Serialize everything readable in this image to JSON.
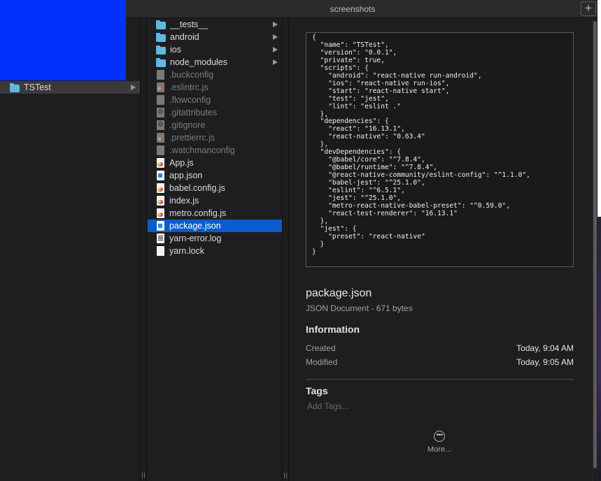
{
  "window": {
    "title": "screenshots",
    "new_tab_symbol": "+"
  },
  "column1": [
    {
      "label": "TSTest",
      "icon": "folder-icon",
      "selected": true,
      "has_children": true
    }
  ],
  "column2": [
    {
      "label": "__tests__",
      "icon": "folder-icon",
      "kind": "folder"
    },
    {
      "label": "android",
      "icon": "folder-icon",
      "kind": "folder"
    },
    {
      "label": "ios",
      "icon": "folder-icon",
      "kind": "folder"
    },
    {
      "label": "node_modules",
      "icon": "folder-icon",
      "kind": "folder"
    },
    {
      "label": ".buckconfig",
      "icon": "document-icon",
      "kind": "hidden"
    },
    {
      "label": ".eslintrc.js",
      "icon": "js-file-icon",
      "kind": "hidden-js"
    },
    {
      "label": ".flowconfig",
      "icon": "document-icon",
      "kind": "hidden"
    },
    {
      "label": ".gitattributes",
      "icon": "gear-file-icon",
      "kind": "hidden-gear"
    },
    {
      "label": ".gitignore",
      "icon": "gear-file-icon",
      "kind": "hidden-gear"
    },
    {
      "label": ".prettierrc.js",
      "icon": "js-file-icon",
      "kind": "hidden-js"
    },
    {
      "label": ".watchmanconfig",
      "icon": "document-icon",
      "kind": "hidden"
    },
    {
      "label": "App.js",
      "icon": "js-file-icon",
      "kind": "js"
    },
    {
      "label": "app.json",
      "icon": "json-file-icon",
      "kind": "json"
    },
    {
      "label": "babel.config.js",
      "icon": "js-file-icon",
      "kind": "js"
    },
    {
      "label": "index.js",
      "icon": "js-file-icon",
      "kind": "js"
    },
    {
      "label": "metro.config.js",
      "icon": "js-file-icon",
      "kind": "js"
    },
    {
      "label": "package.json",
      "icon": "json-file-icon",
      "kind": "json",
      "selected": true
    },
    {
      "label": "yarn-error.log",
      "icon": "log-file-icon",
      "kind": "log"
    },
    {
      "label": "yarn.lock",
      "icon": "document-icon",
      "kind": "doc"
    }
  ],
  "preview": {
    "code": "{\n  \"name\": \"TSTest\",\n  \"version\": \"0.0.1\",\n  \"private\": true,\n  \"scripts\": {\n    \"android\": \"react-native run-android\",\n    \"ios\": \"react-native run-ios\",\n    \"start\": \"react-native start\",\n    \"test\": \"jest\",\n    \"lint\": \"eslint .\"\n  },\n  \"dependencies\": {\n    \"react\": \"16.13.1\",\n    \"react-native\": \"0.63.4\"\n  },\n  \"devDependencies\": {\n    \"@babel/core\": \"^7.8.4\",\n    \"@babel/runtime\": \"^7.8.4\",\n    \"@react-native-community/eslint-config\": \"^1.1.0\",\n    \"babel-jest\": \"^25.1.0\",\n    \"eslint\": \"^6.5.1\",\n    \"jest\": \"^25.1.0\",\n    \"metro-react-native-babel-preset\": \"^0.59.0\",\n    \"react-test-renderer\": \"16.13.1\"\n  },\n  \"jest\": {\n    \"preset\": \"react-native\"\n  }\n}",
    "file_name": "package.json",
    "file_kind": "JSON Document - 671 bytes",
    "information_heading": "Information",
    "created_label": "Created",
    "created_value": "Today, 9:04 AM",
    "modified_label": "Modified",
    "modified_value": "Today, 9:05 AM",
    "tags_heading": "Tags",
    "tags_placeholder": "Add Tags...",
    "more_label": "More..."
  },
  "colors": {
    "selection": "#0a5ccc",
    "folder": "#5fb7e6",
    "desktop_blue": "#0430fb"
  }
}
